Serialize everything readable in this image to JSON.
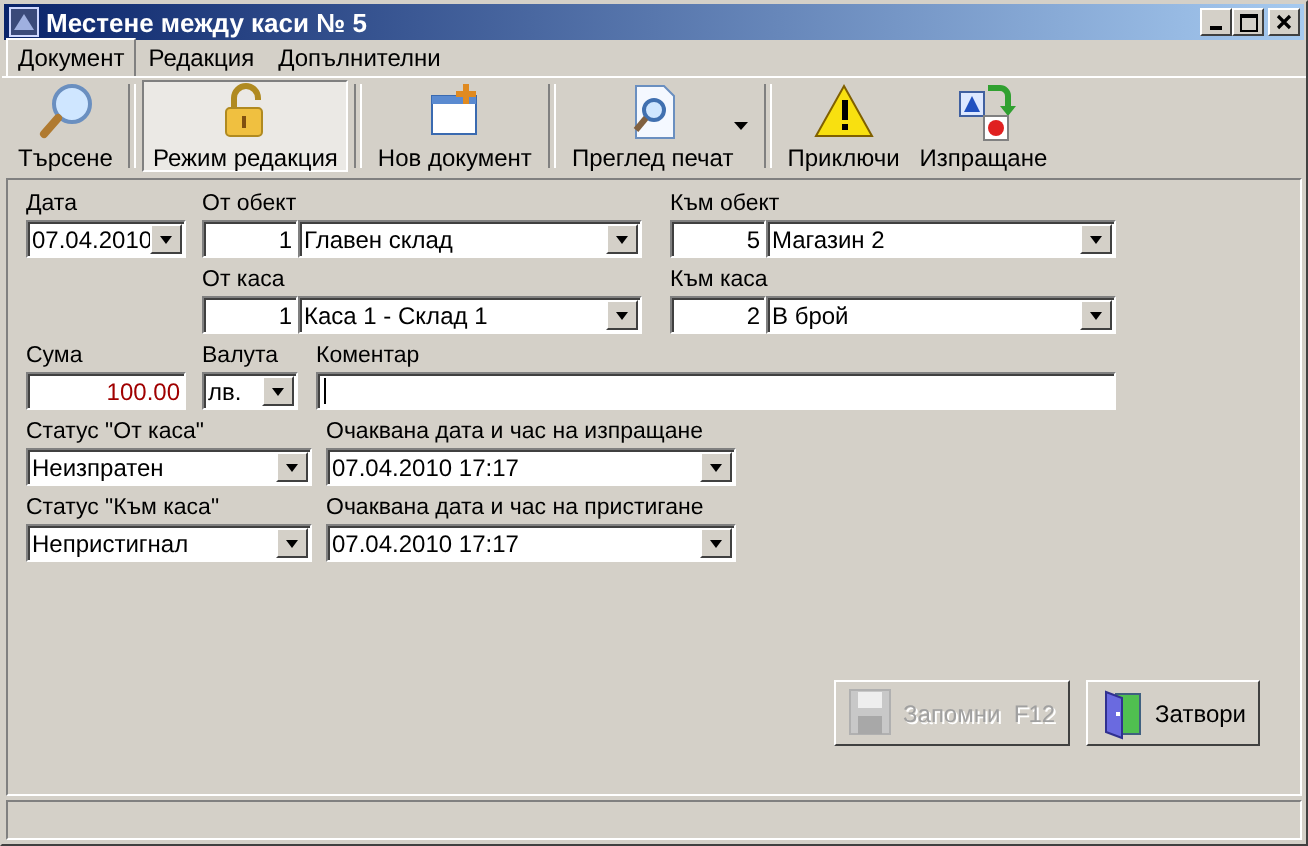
{
  "window": {
    "title": "Местене между каси № 5"
  },
  "menu": [
    {
      "label": "Документ",
      "selected": true
    },
    {
      "label": "Редакция",
      "selected": false
    },
    {
      "label": "Допълнителни",
      "selected": false
    }
  ],
  "toolbar": [
    {
      "items": [
        {
          "label": "Търсене",
          "pressed": false,
          "dropdown": false
        }
      ]
    },
    {
      "items": [
        {
          "label": "Режим редакция",
          "pressed": true,
          "dropdown": false
        }
      ]
    },
    {
      "items": [
        {
          "label": "Нов документ",
          "pressed": false,
          "dropdown": false
        }
      ]
    },
    {
      "items": [
        {
          "label": "Преглед печат",
          "pressed": false,
          "dropdown": true
        }
      ]
    },
    {
      "items": [
        {
          "label": "Приключи",
          "pressed": false,
          "dropdown": false
        },
        {
          "label": "Изпращане",
          "pressed": false,
          "dropdown": false
        }
      ]
    }
  ],
  "form": {
    "date": {
      "label": "Дата",
      "value": "07.04.2010"
    },
    "from_object": {
      "label": "От обект",
      "code": "1",
      "value": "Главен склад"
    },
    "to_object": {
      "label": "Към обект",
      "code": "5",
      "value": "Магазин 2"
    },
    "from_cash": {
      "label": "От каса",
      "code": "1",
      "value": "Каса 1 - Склад 1"
    },
    "to_cash": {
      "label": "Към каса",
      "code": "2",
      "value": "В брой"
    },
    "amount": {
      "label": "Сума",
      "value": "100.00"
    },
    "currency": {
      "label": "Валута",
      "value": "лв."
    },
    "comment": {
      "label": "Коментар"
    },
    "status_from": {
      "label": "Статус \"От каса\"",
      "value": "Неизпратен"
    },
    "expected_send": {
      "label": "Очаквана дата и час на изпращане",
      "value": "07.04.2010 17:17"
    },
    "status_to": {
      "label": "Статус \"Към каса\"",
      "value": "Непристигнал"
    },
    "expected_arrival": {
      "label": "Очаквана дата и час на пристигане",
      "value": "07.04.2010 17:17"
    }
  },
  "buttons": [
    {
      "label": "Запомни  F12",
      "disabled": true
    },
    {
      "label": "Затвори",
      "disabled": false
    }
  ]
}
